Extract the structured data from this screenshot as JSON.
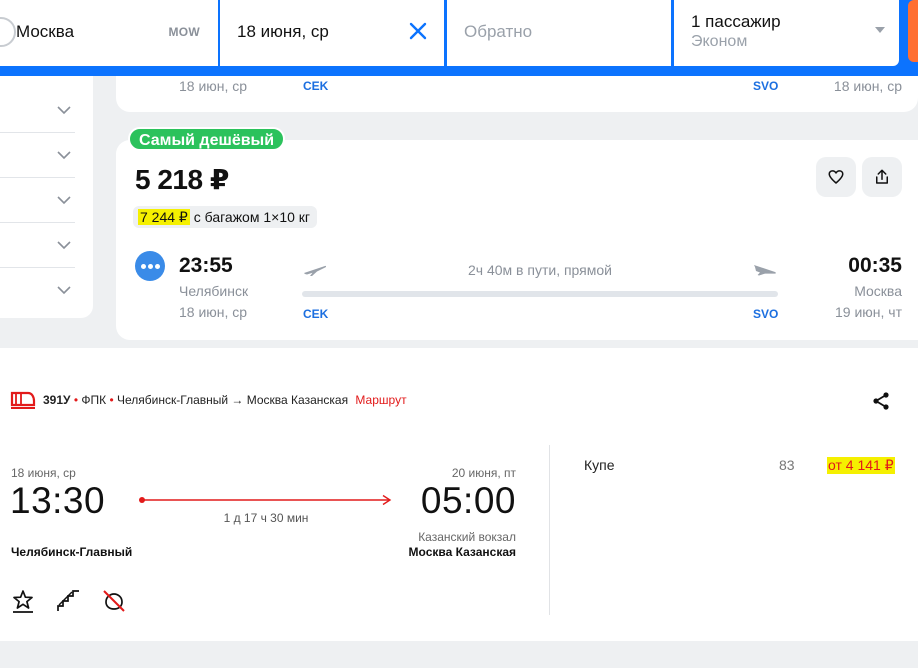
{
  "search": {
    "from_city": "Москва",
    "from_code": "MOW",
    "date": "18 июня, ср",
    "return_placeholder": "Обратно",
    "passengers": "1 пассажир",
    "cabin_class": "Эконом"
  },
  "filters": {
    "count": 5
  },
  "prev_card": {
    "dep_date": "18 июн, ср",
    "dep_code": "CEK",
    "arr_code": "SVO",
    "arr_date": "18 июн, ср"
  },
  "flight": {
    "badge": "Самый дешёвый",
    "price": "5 218 ₽",
    "baggage_price": "7 244 ₽",
    "baggage_text": " с багажом 1×10 кг",
    "dep_time": "23:55",
    "dep_city": "Челябинск",
    "dep_date": "18 июн, ср",
    "dep_code": "CEK",
    "duration": "2ч 40м в пути, прямой",
    "arr_time": "00:35",
    "arr_city": "Москва",
    "arr_date": "19 июн, чт",
    "arr_code": "SVO"
  },
  "train": {
    "number": "391У",
    "operator": "ФПК",
    "route": "Челябинск-Главный → Москва Казанская",
    "route_link": "Маршрут",
    "dep_date": "18 июня, ср",
    "dep_time": "13:30",
    "duration": "1 д 17 ч 30 мин",
    "arr_date": "20 июня, пт",
    "arr_time": "05:00",
    "dep_station": "Челябинск-Главный",
    "arr_station_sub": "Казанский вокзал",
    "arr_station": "Москва Казанская",
    "class_name": "Купе",
    "seats": "83",
    "class_price": "от 4 141 ₽"
  },
  "colors": {
    "brand_blue": "#0c73fe",
    "accent_orange": "#ff6f32",
    "badge_green": "#2bc25c",
    "rzd_red": "#e21a1a",
    "highlight_yellow": "#f5f000"
  }
}
